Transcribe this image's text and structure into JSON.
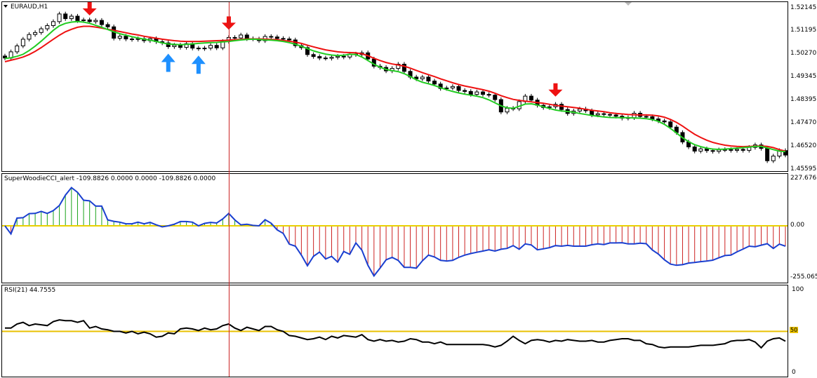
{
  "window": {
    "symbol_label": "EURAUD,H1"
  },
  "indicators": {
    "cci_label": "SuperWoodieCCI_alert -109.8826 0.0000 0.0000 -109.8826 0.0000",
    "rsi_label": "RSI(21) 44.7555"
  },
  "price_axis": {
    "ticks": [
      "1.52145",
      "1.51195",
      "1.50270",
      "1.49345",
      "1.48395",
      "1.47470",
      "1.46520",
      "1.45595"
    ]
  },
  "cci_axis": {
    "ticks": [
      "227.6765",
      "0.00",
      "-255.0657"
    ]
  },
  "rsi_axis": {
    "ticks": [
      "100",
      "50",
      "0"
    ]
  },
  "colors": {
    "bull_histogram": "#1aa31a",
    "bear_histogram": "#cc2222",
    "cci_line": "#1a3fd0",
    "zero_line": "#e8d000",
    "ema_fast": "#22cc22",
    "ema_slow": "#ee1111",
    "rsi_line": "#000000",
    "rsi_level": "#e8c000",
    "sell_arrow": "#ee1111",
    "buy_arrow": "#1e90ff",
    "cursor": "#cc2222"
  },
  "chart_data": [
    {
      "type": "candlestick",
      "title": "EURAUD,H1",
      "ylim": [
        1.4549,
        1.5226
      ],
      "close": [
        1.5003,
        1.5028,
        1.5052,
        1.5079,
        1.5098,
        1.5106,
        1.5121,
        1.5134,
        1.515,
        1.5181,
        1.5162,
        1.5172,
        1.5154,
        1.5157,
        1.515,
        1.5155,
        1.5138,
        1.5129,
        1.5083,
        1.5091,
        1.508,
        1.5078,
        1.5081,
        1.5073,
        1.5081,
        1.5069,
        1.5064,
        1.5049,
        1.5055,
        1.5046,
        1.5061,
        1.5043,
        1.5041,
        1.5043,
        1.5054,
        1.5044,
        1.507,
        1.5086,
        1.5084,
        1.5096,
        1.5081,
        1.508,
        1.5073,
        1.509,
        1.5088,
        1.5082,
        1.508,
        1.5076,
        1.5053,
        1.5045,
        1.5017,
        1.5009,
        1.5003,
        1.5002,
        1.5006,
        1.501,
        1.5007,
        1.5019,
        1.5017,
        1.5024,
        1.4999,
        1.497,
        1.4965,
        1.4951,
        1.4961,
        1.4978,
        1.4949,
        1.4926,
        1.4919,
        1.4926,
        1.491,
        1.4898,
        1.488,
        1.4882,
        1.4888,
        1.4872,
        1.4868,
        1.4856,
        1.4866,
        1.4856,
        1.4853,
        1.4835,
        1.4785,
        1.48,
        1.4798,
        1.4827,
        1.4849,
        1.4833,
        1.4812,
        1.4803,
        1.4806,
        1.4816,
        1.4795,
        1.4779,
        1.4789,
        1.4797,
        1.479,
        1.4773,
        1.4778,
        1.4775,
        1.4773,
        1.4768,
        1.476,
        1.4762,
        1.478,
        1.4767,
        1.4766,
        1.4757,
        1.4749,
        1.4745,
        1.4724,
        1.4702,
        1.4664,
        1.4644,
        1.4627,
        1.4636,
        1.4629,
        1.4626,
        1.4632,
        1.4633,
        1.463,
        1.4634,
        1.463,
        1.4642,
        1.4652,
        1.4638,
        1.4588,
        1.4607,
        1.4629,
        1.4611
      ],
      "ema_fast": [
        1.5001,
        1.5004,
        1.501,
        1.5018,
        1.5033,
        1.5051,
        1.5071,
        1.5093,
        1.5115,
        1.5133,
        1.5143,
        1.5148,
        1.515,
        1.5148,
        1.5143,
        1.5135,
        1.5127,
        1.5118,
        1.5109,
        1.5101,
        1.5095,
        1.5089,
        1.5084,
        1.5079,
        1.5075,
        1.507,
        1.5064,
        1.506,
        1.5058,
        1.5057,
        1.5058,
        1.506,
        1.5062,
        1.5064,
        1.5065,
        1.5066,
        1.5068,
        1.507,
        1.5073,
        1.5076,
        1.5078,
        1.5079,
        1.5078,
        1.5076,
        1.5075,
        1.5073,
        1.507,
        1.5065,
        1.5059,
        1.505,
        1.5041,
        1.5032,
        1.5025,
        1.5019,
        1.5015,
        1.5013,
        1.5014,
        1.5018,
        1.5017,
        1.5007,
        1.4993,
        1.4978,
        1.4966,
        1.4957,
        1.4952,
        1.4948,
        1.494,
        1.4928,
        1.4915,
        1.4905,
        1.4899,
        1.4892,
        1.4883,
        1.4875,
        1.4868,
        1.4862,
        1.4857,
        1.4853,
        1.4849,
        1.4843,
        1.4834,
        1.4822,
        1.481,
        1.4802,
        1.48,
        1.4808,
        1.4817,
        1.4818,
        1.4813,
        1.4806,
        1.4799,
        1.4793,
        1.4789,
        1.4787,
        1.4784,
        1.4779,
        1.4775,
        1.4771,
        1.4768,
        1.4765,
        1.4763,
        1.4762,
        1.4762,
        1.4762,
        1.4761,
        1.476,
        1.4758,
        1.4754,
        1.4747,
        1.4735,
        1.4719,
        1.47,
        1.4681,
        1.4665,
        1.4653,
        1.4645,
        1.4639,
        1.4635,
        1.4634,
        1.4635,
        1.4637,
        1.4639,
        1.4641,
        1.4643,
        1.4646,
        1.4646,
        1.464,
        1.4633,
        1.4627,
        1.4625
      ],
      "ema_slow": [
        1.4988,
        1.4994,
        1.5,
        1.5007,
        1.5017,
        1.503,
        1.5045,
        1.5062,
        1.5079,
        1.5095,
        1.5109,
        1.5119,
        1.5127,
        1.5131,
        1.5131,
        1.5128,
        1.5124,
        1.5119,
        1.5115,
        1.511,
        1.5105,
        1.51,
        1.5096,
        1.5091,
        1.5087,
        1.5083,
        1.5079,
        1.5076,
        1.5073,
        1.5071,
        1.507,
        1.507,
        1.507,
        1.5071,
        1.5072,
        1.5073,
        1.5074,
        1.5075,
        1.5077,
        1.5078,
        1.508,
        1.508,
        1.508,
        1.5079,
        1.5078,
        1.5077,
        1.5074,
        1.5071,
        1.5067,
        1.5062,
        1.5055,
        1.5048,
        1.5042,
        1.5036,
        1.5032,
        1.5028,
        1.5026,
        1.5025,
        1.5024,
        1.502,
        1.5012,
        1.5002,
        1.4993,
        1.4985,
        1.4979,
        1.4975,
        1.497,
        1.4962,
        1.4953,
        1.4944,
        1.4936,
        1.4928,
        1.4919,
        1.4911,
        1.4903,
        1.4896,
        1.489,
        1.4885,
        1.488,
        1.4875,
        1.4869,
        1.4861,
        1.4851,
        1.4843,
        1.4836,
        1.4832,
        1.4829,
        1.4826,
        1.4823,
        1.482,
        1.4816,
        1.4812,
        1.4809,
        1.4806,
        1.4803,
        1.48,
        1.4796,
        1.4792,
        1.4789,
        1.4786,
        1.4782,
        1.4779,
        1.4777,
        1.4775,
        1.4774,
        1.4773,
        1.4773,
        1.4772,
        1.4769,
        1.4764,
        1.4755,
        1.4743,
        1.4728,
        1.4711,
        1.4695,
        1.4682,
        1.4671,
        1.4662,
        1.4656,
        1.4651,
        1.4648,
        1.4646,
        1.4645,
        1.4646,
        1.4647,
        1.4648,
        1.4646,
        1.4641,
        1.4633,
        1.4627
      ],
      "sell_signals": [
        14,
        37,
        91
      ],
      "buy_signals": [
        27,
        32
      ]
    },
    {
      "type": "histogram",
      "title": "SuperWoodieCCI_alert -109.8826 0.0000 0.0000 -109.8826 0.0000",
      "ylim": [
        -255.0657,
        227.6765
      ],
      "values": [
        0,
        -40,
        38,
        40,
        60,
        61,
        71,
        61,
        75,
        100,
        151,
        188,
        165,
        126,
        123,
        97,
        97,
        29,
        22,
        18,
        10,
        10,
        18,
        10,
        17,
        5,
        -5,
        0,
        8,
        21,
        21,
        18,
        0,
        12,
        17,
        14,
        34,
        61,
        29,
        5,
        8,
        2,
        0,
        30,
        13,
        -20,
        -37,
        -90,
        -100,
        -144,
        -196,
        -150,
        -129,
        -163,
        -150,
        -178,
        -126,
        -140,
        -84,
        -120,
        -194,
        -246,
        -208,
        -167,
        -155,
        -170,
        -204,
        -204,
        -208,
        -172,
        -144,
        -153,
        -170,
        -173,
        -170,
        -155,
        -144,
        -136,
        -130,
        -124,
        -118,
        -124,
        -115,
        -111,
        -97,
        -115,
        -89,
        -94,
        -118,
        -113,
        -107,
        -97,
        -100,
        -96,
        -100,
        -100,
        -100,
        -93,
        -89,
        -92,
        -84,
        -84,
        -83,
        -89,
        -89,
        -85,
        -88,
        -119,
        -139,
        -167,
        -188,
        -194,
        -191,
        -183,
        -180,
        -176,
        -173,
        -169,
        -157,
        -146,
        -144,
        -128,
        -114,
        -100,
        -103,
        -95,
        -88,
        -111,
        -90,
        -100
      ]
    },
    {
      "type": "line",
      "title": "RSI(21) 44.7555",
      "ylim": [
        0,
        100
      ],
      "level": 50,
      "values": [
        54,
        54,
        59,
        61,
        57,
        59,
        58,
        57,
        62,
        64,
        63,
        63,
        61,
        63,
        54,
        56,
        53,
        52,
        50,
        50,
        48,
        50,
        47,
        49,
        47,
        43,
        44,
        48,
        47,
        53,
        54,
        53,
        51,
        54,
        52,
        53,
        57,
        59,
        54,
        51,
        55,
        53,
        51,
        56,
        56,
        52,
        50,
        45,
        44,
        42,
        40,
        41,
        43,
        40,
        44,
        42,
        45,
        44,
        43,
        46,
        40,
        38,
        40,
        38,
        39,
        37,
        38,
        41,
        40,
        37,
        37,
        35,
        37,
        34,
        34,
        34,
        34,
        34,
        34,
        34,
        33,
        31,
        33,
        38,
        44,
        39,
        35,
        39,
        40,
        39,
        37,
        39,
        38,
        40,
        39,
        38,
        38,
        39,
        37,
        37,
        39,
        40,
        41,
        41,
        39,
        39,
        35,
        34,
        31,
        30,
        31,
        31,
        31,
        31,
        32,
        33,
        33,
        33,
        34,
        35,
        38,
        39,
        39,
        40,
        37,
        30,
        38,
        41,
        42,
        38
      ]
    }
  ]
}
